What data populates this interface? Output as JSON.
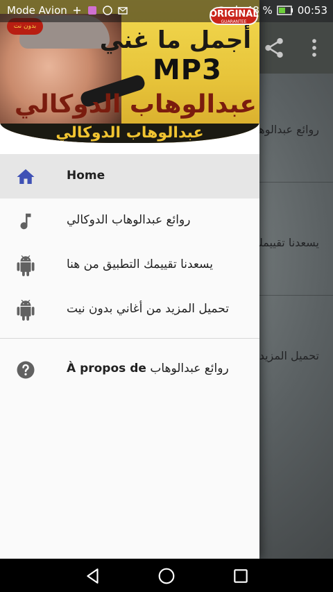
{
  "status_bar": {
    "carrier": "Mode Avion",
    "battery": "48 %",
    "time": "00:53"
  },
  "background_app": {
    "rows": [
      "روائع عبدالوهاب الدوكالي",
      "يسعدنا تقييمك التطبيق من هنا",
      "تحميل المزيد من أغاني بدون نيت"
    ],
    "actions": {
      "share_icon": "share-icon",
      "more_icon": "more-vert-icon"
    }
  },
  "drawer": {
    "header": {
      "title_line1": "أجمل ما غني",
      "mp3": "MP3",
      "title_line2": "عبدالوهاب الدوكالي",
      "subtitle": "عبدالوهاب الدوكالي",
      "badge_text": "بدون نت",
      "original_badge": "ORIGINAL",
      "original_badge_sub": "GUARANTEE"
    },
    "items": [
      {
        "label": "Home",
        "icon": "home-icon",
        "selected": true
      },
      {
        "label": "روائع عبدالوهاب الدوكالي",
        "icon": "music-note-icon",
        "selected": false
      },
      {
        "label": "يسعدنا تقييمك التطبيق من هنا",
        "icon": "android-icon",
        "selected": false
      },
      {
        "label": "تحميل المزيد من أغاني بدون نيت",
        "icon": "android-icon",
        "selected": false
      }
    ],
    "about": {
      "label_prefix": "À propos de",
      "label_suffix": "روائع عبدالوهاب",
      "icon": "help-icon"
    }
  },
  "colors": {
    "accent": "#3f51b5",
    "icon_grey": "#616161",
    "selected_bg": "#e6e6e6"
  },
  "nav_bar": {
    "back_icon": "back-triangle-icon",
    "home_icon": "home-circle-icon",
    "recent_icon": "recent-square-icon"
  }
}
